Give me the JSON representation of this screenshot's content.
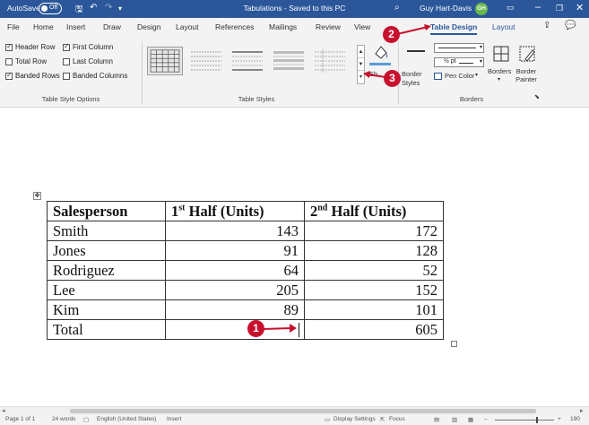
{
  "titlebar": {
    "autosave_label": "AutoSave",
    "autosave_state": "Off",
    "title": "Tabulations - Saved to this PC",
    "user_name": "Guy Hart-Davis",
    "user_initials": "GH"
  },
  "tabs": [
    {
      "label": "File"
    },
    {
      "label": "Home"
    },
    {
      "label": "Insert"
    },
    {
      "label": "Draw"
    },
    {
      "label": "Design"
    },
    {
      "label": "Layout"
    },
    {
      "label": "References"
    },
    {
      "label": "Mailings"
    },
    {
      "label": "Review"
    },
    {
      "label": "View"
    },
    {
      "label": "Table Design"
    },
    {
      "label": "Layout"
    }
  ],
  "table_style_options": {
    "header_row": "Header Row",
    "first_column": "First Column",
    "total_row": "Total Row",
    "last_column": "Last Column",
    "banded_rows": "Banded Rows",
    "banded_columns": "Banded Columns",
    "group_label": "Table Style Options"
  },
  "table_styles": {
    "group_label": "Table Styles"
  },
  "borders": {
    "shading": "Sh",
    "border_styles": "Border Styles",
    "weight": "½ pt",
    "pen_color": "Pen Color",
    "borders_btn": "Borders",
    "border_painter": "Border Painter",
    "group_label": "Borders"
  },
  "callouts": [
    "1",
    "2",
    "3"
  ],
  "table": {
    "header": [
      "Salesperson",
      "1",
      "st",
      " Half (Units)",
      "2",
      "nd",
      " Half (Units)"
    ],
    "rows": [
      [
        "Smith",
        "143",
        "172"
      ],
      [
        "Jones",
        "91",
        "128"
      ],
      [
        "Rodriguez",
        "64",
        "52"
      ],
      [
        "Lee",
        "205",
        "152"
      ],
      [
        "Kim",
        "89",
        "101"
      ],
      [
        "Total",
        "",
        "605"
      ]
    ]
  },
  "status": {
    "page": "Page 1 of 1",
    "words": "24 words",
    "language": "English (United States)",
    "mode": "Insert",
    "display": "Display Settings",
    "focus": "Focus",
    "zoom": "190"
  },
  "colors": {
    "accent": "#2b579a",
    "callout": "#c8102e"
  }
}
